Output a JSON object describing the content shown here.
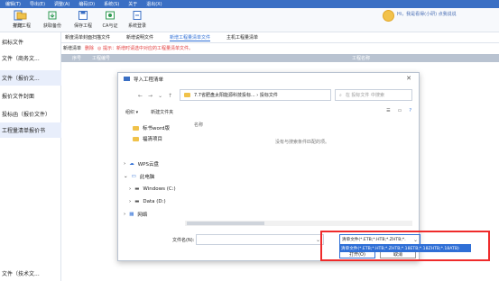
{
  "menubar": {
    "items": [
      "编辑(T)",
      "导出(E)",
      "调整(A)",
      "编码(D)",
      "系统(S)",
      "关于",
      "退出(X)"
    ]
  },
  "toolbar": {
    "buttons": [
      {
        "label": "新建",
        "icon": "new-document-icon"
      },
      {
        "label": "打开工程",
        "icon": "folder-open-icon"
      },
      {
        "label": "获取备份",
        "icon": "cloud-download-icon"
      },
      {
        "label": "保存工程",
        "icon": "save-icon"
      },
      {
        "label": "CA与证",
        "icon": "certificate-icon"
      },
      {
        "label": "系统登录",
        "icon": "login-icon"
      }
    ],
    "user_text": "Hi，我是看得(小研)  点我说说"
  },
  "sidebar": {
    "items": [
      {
        "label": "招标文件",
        "active": false
      },
      {
        "label": "文件（商务文...",
        "active": false
      },
      {
        "label": "文件（报价文...",
        "active": true
      },
      {
        "label": "报价文件封面",
        "active": false
      },
      {
        "label": "投标函（报价文件）",
        "active": false
      },
      {
        "label": "工程量清单报价书",
        "active": true
      },
      {
        "label": "文件（技术文...",
        "active": false
      }
    ]
  },
  "tabs": [
    "新度清单封面扫描文件",
    "新增说明文件",
    "新增工程量清单文件",
    "主机工程量清单"
  ],
  "active_tab": 2,
  "subbar": {
    "new_label": "新增清单",
    "delete_label": "删除",
    "tip": "◎ 提示：新增时请选中对应的工程量清单文件。"
  },
  "table": {
    "headers": [
      "序号",
      "工程编号",
      "工程名称"
    ]
  },
  "dialog": {
    "title": "导入工程清单",
    "path": "7.7省肥盘太阳能源科技投标... › 投标文件",
    "search_placeholder": "在 投标文件 中搜索",
    "cmd_organize": "组织 ▾",
    "cmd_new_folder": "新建文件夹",
    "tree": [
      {
        "label": "标书word版",
        "icon": "folder-icon"
      },
      {
        "label": "福清项目",
        "icon": "folder-icon"
      },
      {
        "label": "WPS云盘",
        "icon": "cloud-icon"
      },
      {
        "label": "此电脑",
        "icon": "computer-icon"
      },
      {
        "label": "Windows (C:)",
        "icon": "drive-icon"
      },
      {
        "label": "Data (D:)",
        "icon": "drive-icon"
      },
      {
        "label": "网络",
        "icon": "network-icon"
      }
    ],
    "column_name": "名称",
    "empty_message": "没有与搜索条件匹配的项。",
    "filename_label": "文件名(N):",
    "filetype_value": "清单文件(*.ETB;*.HTB;*.ZHTB;*.",
    "filetype_option": "清单文件(*.ETB;*.HTB;*.ZHTB;*.18ETB;*.18ZHTB;*.18ATB)",
    "open_label": "打开(O)",
    "cancel_label": "取消"
  }
}
